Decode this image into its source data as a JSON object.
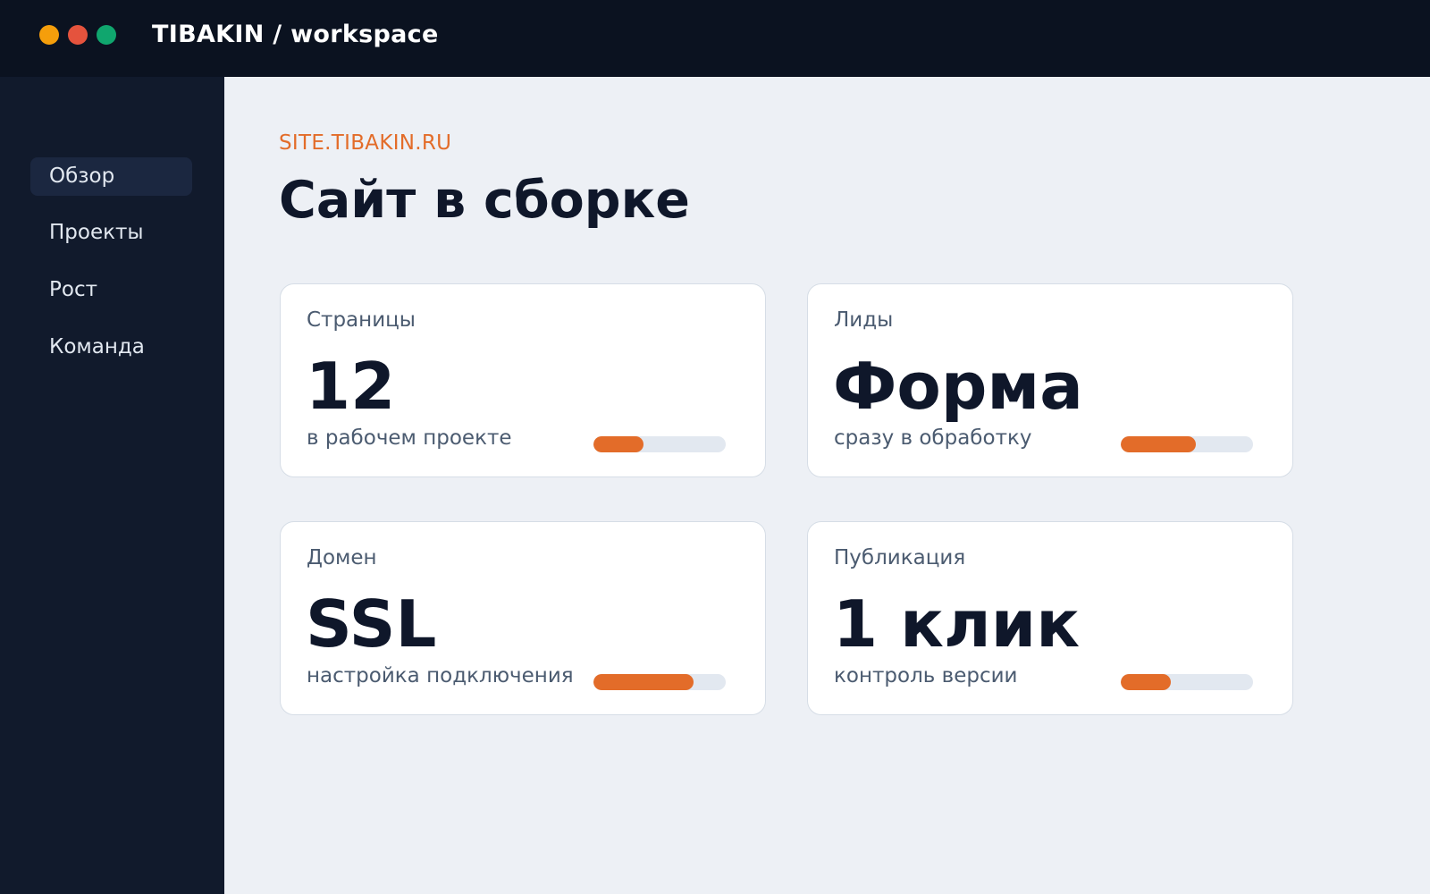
{
  "window": {
    "title": "TIBAKIN / workspace",
    "controls": [
      {
        "name": "minimize-dot",
        "color": "#f59e0b"
      },
      {
        "name": "close-dot",
        "color": "#e5533d"
      },
      {
        "name": "maximize-dot",
        "color": "#10a66e"
      }
    ]
  },
  "sidebar": {
    "items": [
      {
        "label": "Обзор",
        "active": true
      },
      {
        "label": "Проекты",
        "active": false
      },
      {
        "label": "Рост",
        "active": false
      },
      {
        "label": "Команда",
        "active": false
      }
    ]
  },
  "header": {
    "eyebrow": "SITE.TIBAKIN.RU",
    "title": "Сайт в сборке"
  },
  "cards": [
    {
      "label": "Страницы",
      "value": "12",
      "sub": "в рабочем проекте",
      "progress": 0.38
    },
    {
      "label": "Лиды",
      "value": "Форма",
      "sub": "сразу в обработку",
      "progress": 0.57
    },
    {
      "label": "Домен",
      "value": "SSL",
      "sub": "настройка подключения",
      "progress": 0.76
    },
    {
      "label": "Публикация",
      "value": "1 клик",
      "sub": "контроль версии",
      "progress": 0.38
    }
  ],
  "colors": {
    "accent": "#e36c29",
    "topbar": "#0b1220",
    "sidebar": "#111a2c",
    "background": "#edf0f5"
  }
}
